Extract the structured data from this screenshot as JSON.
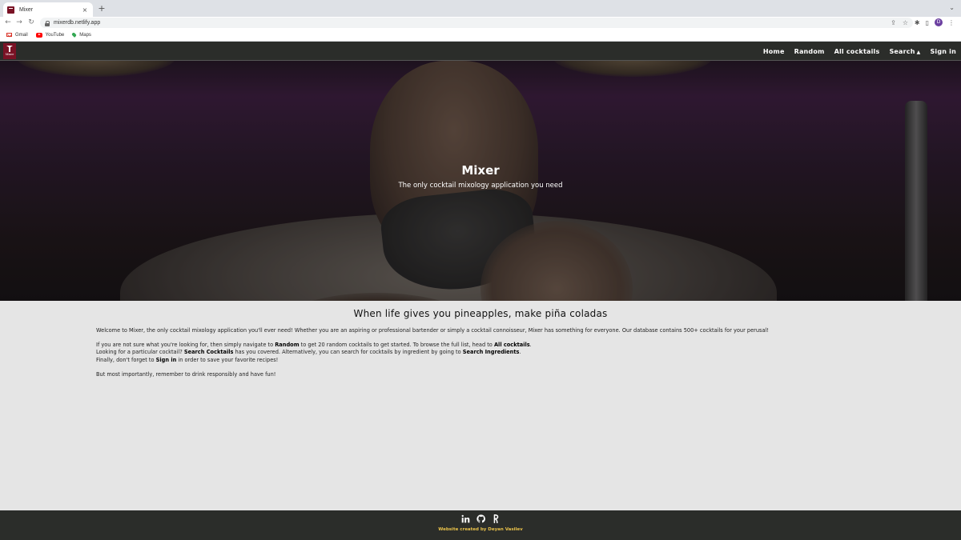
{
  "browser": {
    "tab_title": "Mixer",
    "tab_close": "×",
    "new_tab": "+",
    "url": "mixerdb.netlify.app",
    "profile_initial": "D",
    "bookmarks": [
      {
        "label": "Gmail",
        "icon": "gmail-icon"
      },
      {
        "label": "YouTube",
        "icon": "youtube-icon"
      },
      {
        "label": "Maps",
        "icon": "maps-icon"
      }
    ]
  },
  "nav": {
    "logo_text": "Mixer",
    "links": [
      "Home",
      "Random",
      "All cocktails",
      "Search",
      "Sign in"
    ],
    "search_caret": "▲"
  },
  "hero": {
    "title": "Mixer",
    "subtitle": "The only cocktail mixology application you need"
  },
  "main": {
    "heading": "When life gives you pineapples, make piña coladas",
    "intro": "Welcome to Mixer, the only cocktail mixology application you'll ever need! Whether you are an aspiring or professional bartender or simply a cocktail connoisseur, Mixer has something for everyone. Our database contains 500+ cocktails for your perusal!",
    "line1": {
      "pre": "If you are not sure what you're looking for, then simply navigate to ",
      "b1": "Random",
      "mid": " to get 20 random cocktails to get started. To browse the full list, head to ",
      "b2": "All cocktails",
      "post": "."
    },
    "line2": {
      "pre": "Looking for a particular cocktail? ",
      "b1": "Search Cocktails",
      "mid": " has you covered. Alternatively, you can search for cocktails by ingredient by going to ",
      "b2": "Search Ingredients",
      "post": "."
    },
    "line3": {
      "pre": "Finally, don't forget to ",
      "b1": "Sign in",
      "post": " in order to save your favorite recipes!"
    },
    "closing": "But most importantly, remember to drink responsibly and have fun!"
  },
  "footer": {
    "icons": [
      "linkedin-icon",
      "github-icon",
      "portfolio-icon"
    ],
    "credit": "Website created by Deyan Vasilev"
  },
  "colors": {
    "navbar_bg": "#2b2d2a",
    "page_bg": "#e5e5e5",
    "logo_bg": "#7a1225",
    "credit_text": "#e8c14a"
  }
}
